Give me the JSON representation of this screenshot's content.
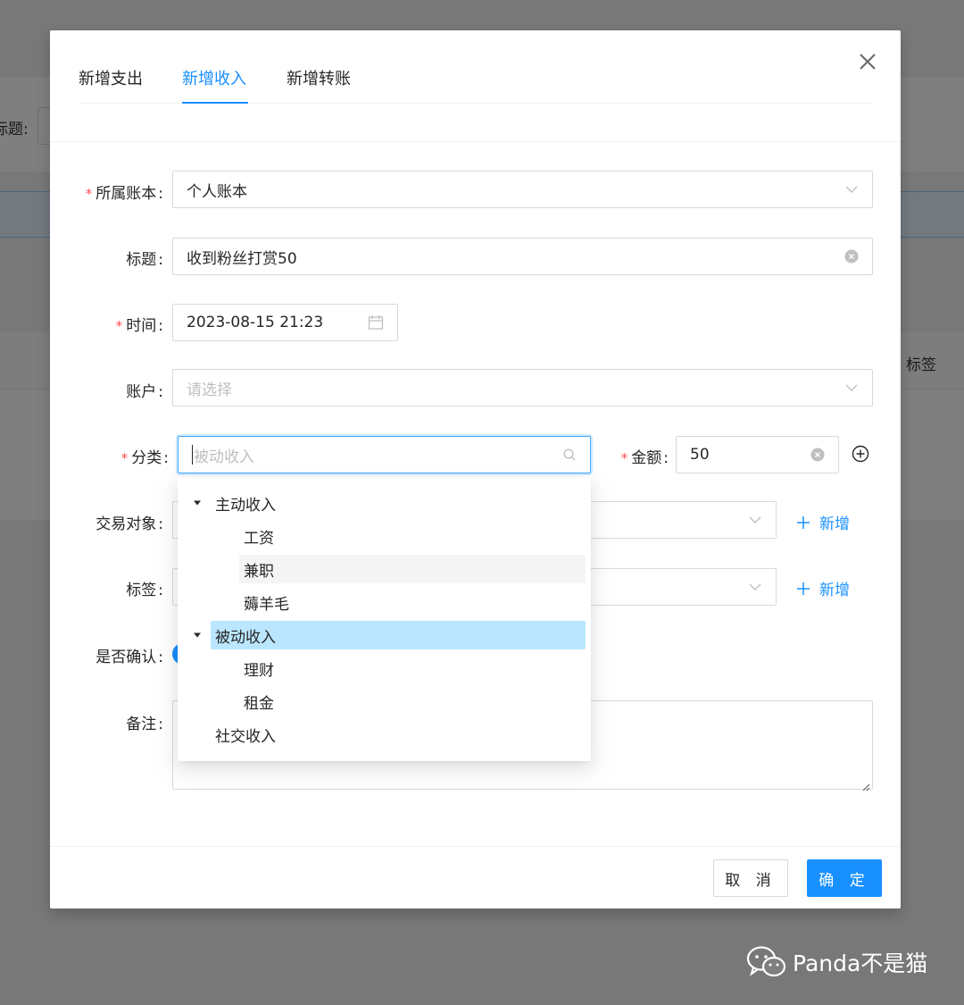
{
  "background": {
    "title_label": "标题:",
    "tag_column": "标签"
  },
  "modal": {
    "tabs": [
      {
        "label": "新增支出",
        "active": false
      },
      {
        "label": "新增收入",
        "active": true
      },
      {
        "label": "新增转账",
        "active": false
      }
    ],
    "fields": {
      "book": {
        "label": "所属账本",
        "value": "个人账本",
        "required": true
      },
      "title": {
        "label": "标题",
        "value": "收到粉丝打赏50",
        "required": false
      },
      "time": {
        "label": "时间",
        "value": "2023-08-15 21:23",
        "required": true
      },
      "account": {
        "label": "账户",
        "placeholder": "请选择",
        "required": false
      },
      "category": {
        "label": "分类",
        "placeholder": "被动收入",
        "required": true
      },
      "amount": {
        "label": "金额",
        "value": "50",
        "required": true
      },
      "counterparty": {
        "label": "交易对象",
        "add_label": "新增"
      },
      "tags": {
        "label": "标签",
        "add_label": "新增"
      },
      "confirmed": {
        "label": "是否确认",
        "on": true
      },
      "note": {
        "label": "备注"
      }
    },
    "buttons": {
      "cancel": "取 消",
      "ok": "确 定"
    }
  },
  "category_tree": [
    {
      "label": "主动收入",
      "expanded": true,
      "children": [
        "工资",
        "兼职",
        "薅羊毛"
      ]
    },
    {
      "label": "被动收入",
      "expanded": true,
      "selected": true,
      "children": [
        "理财",
        "租金"
      ]
    },
    {
      "label": "社交收入",
      "expanded": false,
      "children": []
    }
  ],
  "tree_state": {
    "hovered": "兼职",
    "selected": "被动收入"
  },
  "watermark": {
    "text": "Panda不是猫"
  },
  "colors": {
    "primary": "#1890ff",
    "required": "#ff4d4f",
    "selected_bg": "#bae7ff",
    "hover_bg": "#f5f5f5"
  }
}
